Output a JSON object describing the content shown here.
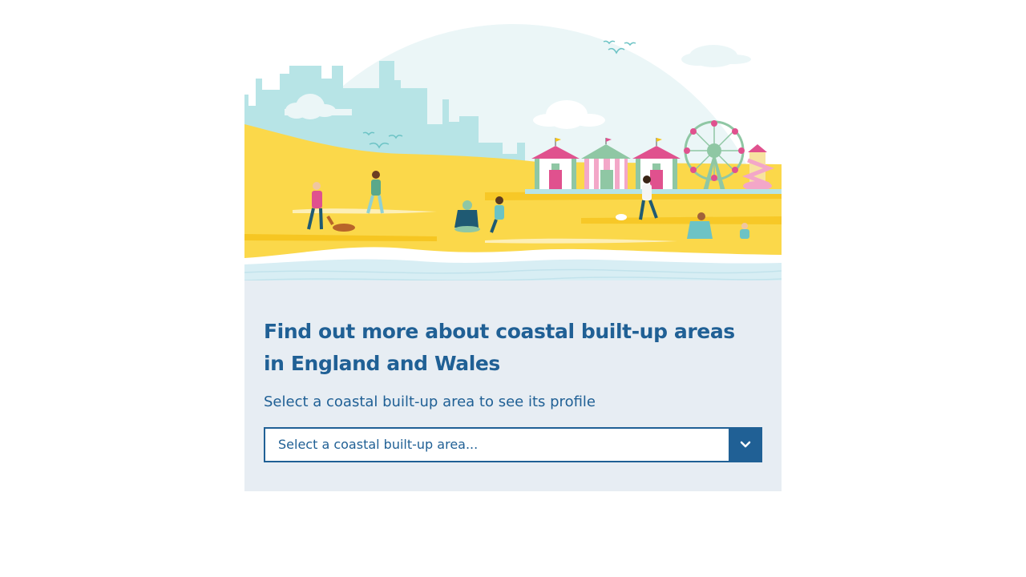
{
  "illustration": {
    "name": "coastal-beach-illustration",
    "colors": {
      "sky_circle": "#ebf6f7",
      "skyline": "#b7e4e6",
      "sand": "#fbd84a",
      "sand_dark": "#f5c218",
      "sea": "#d8eef4",
      "hut_pink": "#e0518e",
      "hut_green": "#8fc7a4"
    }
  },
  "panel": {
    "title": "Find out more about coastal built-up areas in England and Wales",
    "subtitle": "Select a coastal built-up area to see its profile"
  },
  "select": {
    "value": "Select a coastal built-up area...",
    "button_icon": "chevron-down-icon"
  },
  "colors": {
    "accent": "#206095",
    "panel_bg": "#e7edf3"
  }
}
